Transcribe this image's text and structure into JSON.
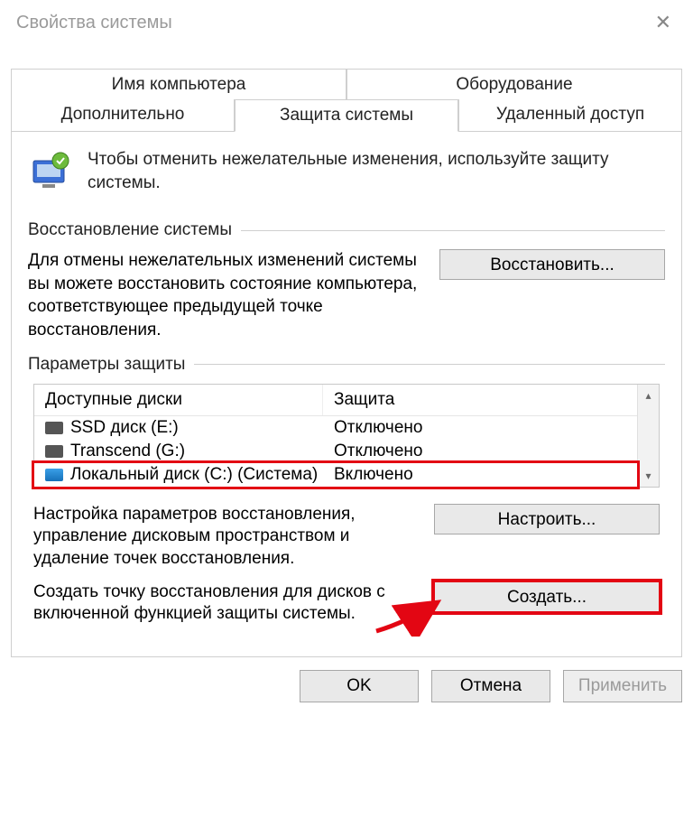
{
  "window": {
    "title": "Свойства системы"
  },
  "tabs": {
    "row1": [
      "Имя компьютера",
      "Оборудование"
    ],
    "row2": [
      "Дополнительно",
      "Защита системы",
      "Удаленный доступ"
    ],
    "active": "Защита системы"
  },
  "intro": "Чтобы отменить нежелательные изменения, используйте защиту системы.",
  "groups": {
    "restore_label": "Восстановление системы",
    "restore_text": "Для отмены нежелательных изменений системы вы можете восстановить состояние компьютера, соответствующее предыдущей точке восстановления.",
    "restore_btn": "Восстановить...",
    "params_label": "Параметры защиты",
    "drives_header": {
      "col1": "Доступные диски",
      "col2": "Защита"
    },
    "drives": [
      {
        "name": "SSD диск (E:)",
        "status": "Отключено",
        "icon": "drive",
        "highlight": false
      },
      {
        "name": "Transcend (G:)",
        "status": "Отключено",
        "icon": "drive",
        "highlight": false
      },
      {
        "name": "Локальный диск (C:) (Система)",
        "status": "Включено",
        "icon": "system",
        "highlight": true
      }
    ],
    "configure_text": "Настройка параметров восстановления, управление дисковым пространством и удаление точек восстановления.",
    "configure_btn": "Настроить...",
    "create_text": "Создать точку восстановления для дисков с включенной функцией защиты системы.",
    "create_btn": "Создать..."
  },
  "footer": {
    "ok": "OK",
    "cancel": "Отмена",
    "apply": "Применить"
  }
}
